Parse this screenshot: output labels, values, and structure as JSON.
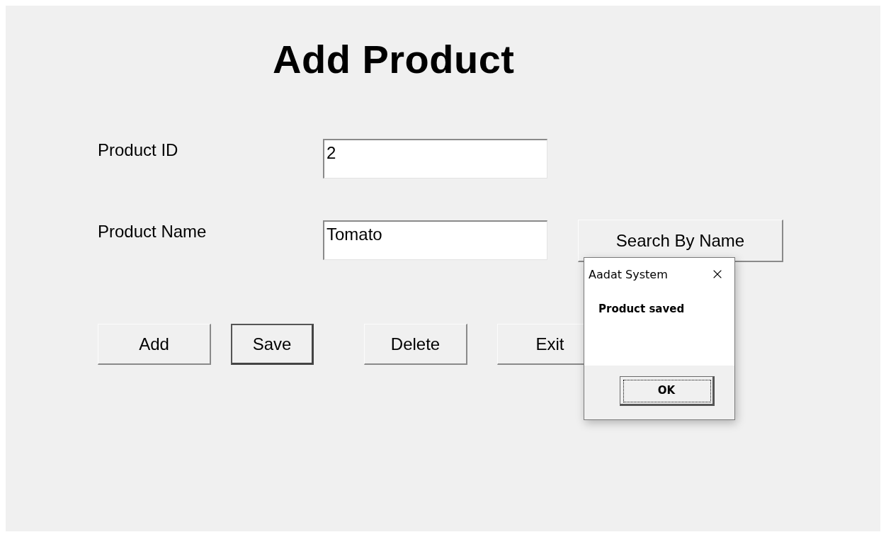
{
  "form": {
    "title": "Add Product",
    "fields": [
      {
        "label": "Product ID",
        "value": "2"
      },
      {
        "label": "Product Name",
        "value": "Tomato"
      }
    ],
    "search_button": "Search By Name",
    "buttons": [
      {
        "label": "Add",
        "focused": false
      },
      {
        "label": "Save",
        "focused": true
      },
      {
        "label": "Delete",
        "focused": false
      },
      {
        "label": "Exit",
        "focused": false
      }
    ]
  },
  "dialog": {
    "title": "Aadat System",
    "message": "Product saved",
    "button": {
      "label": "OK",
      "focused": true
    }
  }
}
